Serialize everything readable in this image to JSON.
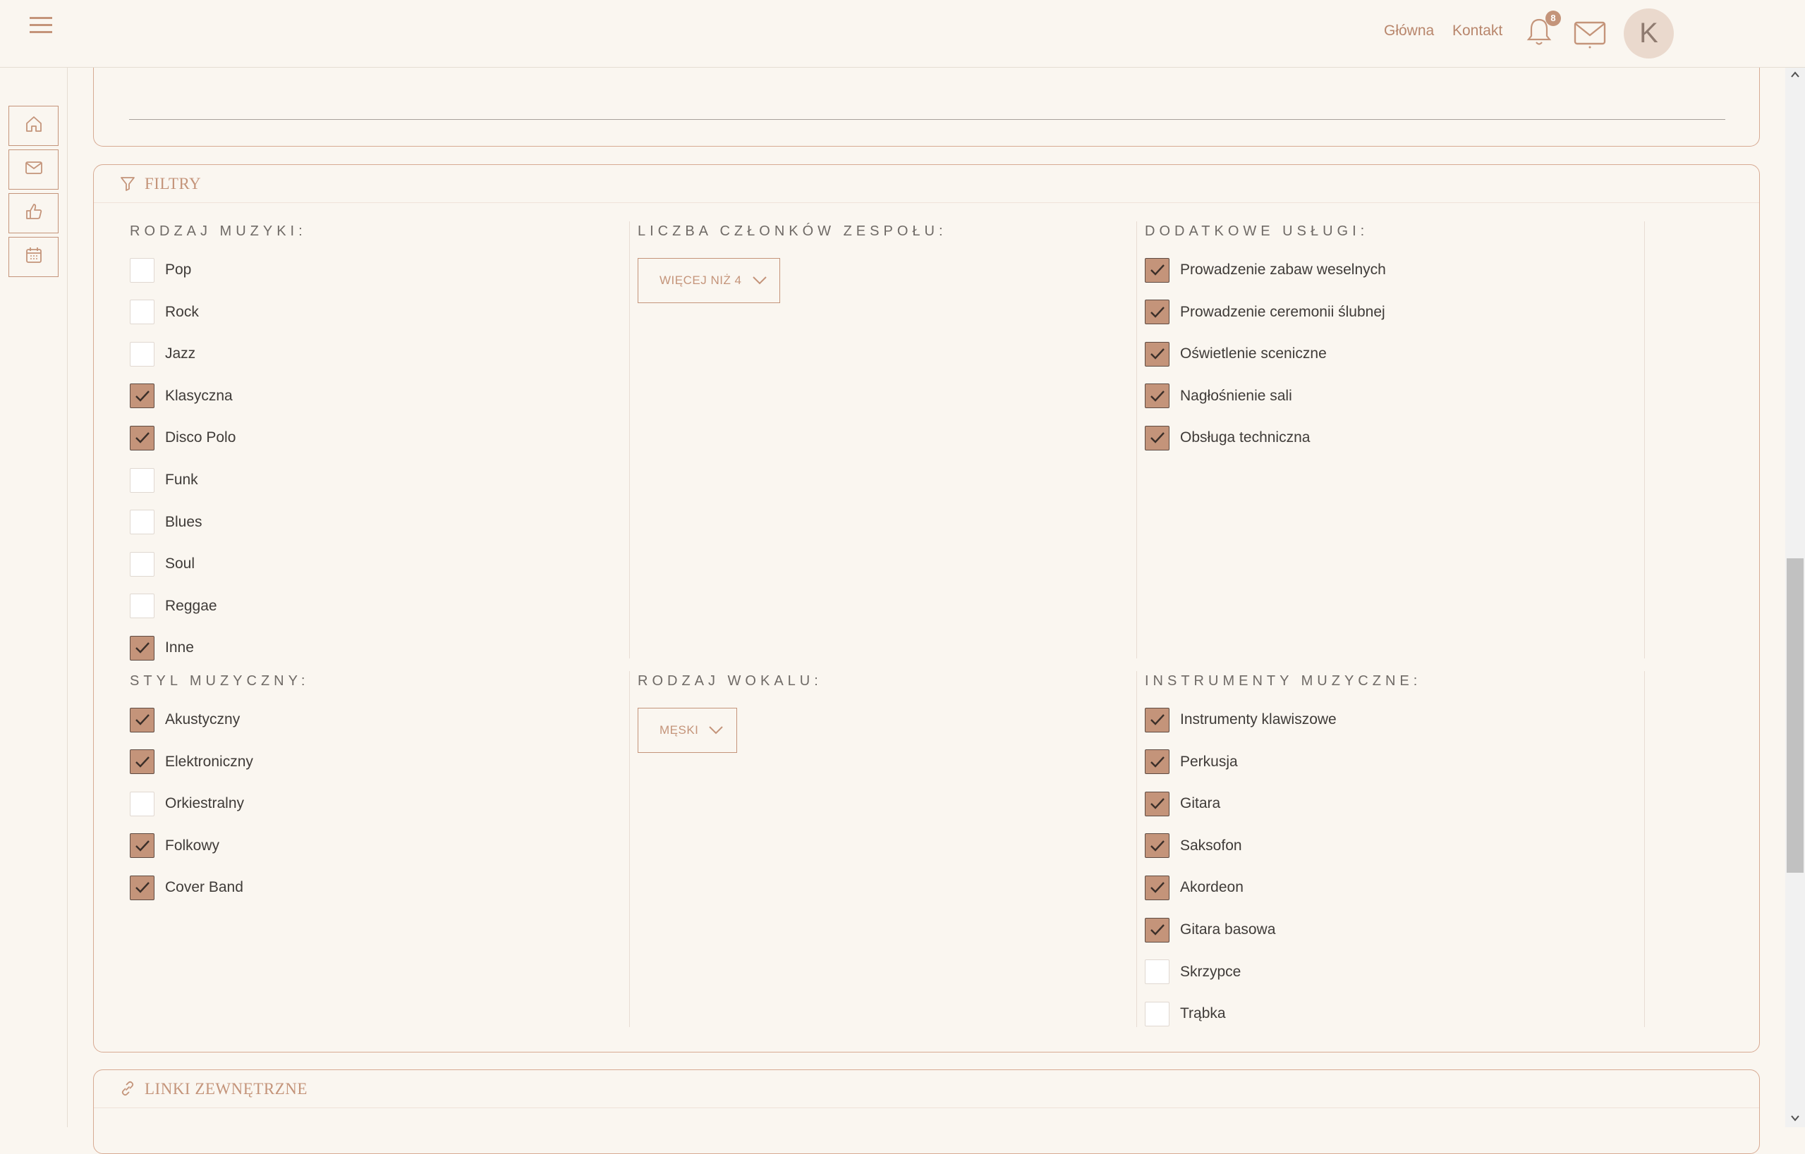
{
  "header": {
    "nav": [
      "Główna",
      "Kontakt"
    ],
    "notifications_count": "8",
    "avatar_initial": "K"
  },
  "rail": {
    "items": [
      "home-icon",
      "mail-icon",
      "thumbs-up-icon",
      "calendar-icon"
    ]
  },
  "filters": {
    "title": "FILTRY",
    "music_type": {
      "title": "RODZAJ MUZYKI:",
      "options": [
        {
          "label": "Pop",
          "checked": false
        },
        {
          "label": "Rock",
          "checked": false
        },
        {
          "label": "Jazz",
          "checked": false
        },
        {
          "label": "Klasyczna",
          "checked": true
        },
        {
          "label": "Disco Polo",
          "checked": true
        },
        {
          "label": "Funk",
          "checked": false
        },
        {
          "label": "Blues",
          "checked": false
        },
        {
          "label": "Soul",
          "checked": false
        },
        {
          "label": "Reggae",
          "checked": false
        },
        {
          "label": "Inne",
          "checked": true
        }
      ]
    },
    "members": {
      "title": "LICZBA CZŁONKÓW ZESPOŁU:",
      "selected": "WIĘCEJ NIŻ 4"
    },
    "extra_services": {
      "title": "DODATKOWE USŁUGI:",
      "options": [
        {
          "label": "Prowadzenie zabaw weselnych",
          "checked": true
        },
        {
          "label": "Prowadzenie ceremonii ślubnej",
          "checked": true
        },
        {
          "label": "Oświetlenie sceniczne",
          "checked": true
        },
        {
          "label": "Nagłośnienie sali",
          "checked": true
        },
        {
          "label": "Obsługa techniczna",
          "checked": true
        }
      ]
    },
    "music_style": {
      "title": "STYL MUZYCZNY:",
      "options": [
        {
          "label": "Akustyczny",
          "checked": true
        },
        {
          "label": "Elektroniczny",
          "checked": true
        },
        {
          "label": "Orkiestralny",
          "checked": false
        },
        {
          "label": "Folkowy",
          "checked": true
        },
        {
          "label": "Cover Band",
          "checked": true
        }
      ]
    },
    "vocal_type": {
      "title": "RODZAJ WOKALU:",
      "selected": "MĘSKI"
    },
    "instruments": {
      "title": "INSTRUMENTY MUZYCZNE:",
      "options": [
        {
          "label": "Instrumenty klawiszowe",
          "checked": true
        },
        {
          "label": "Perkusja",
          "checked": true
        },
        {
          "label": "Gitara",
          "checked": true
        },
        {
          "label": "Saksofon",
          "checked": true
        },
        {
          "label": "Akordeon",
          "checked": true
        },
        {
          "label": "Gitara basowa",
          "checked": true
        },
        {
          "label": "Skrzypce",
          "checked": false
        },
        {
          "label": "Trąbka",
          "checked": false
        }
      ]
    }
  },
  "links": {
    "title": "LINKI ZEWNĘTRZNE"
  },
  "colors": {
    "accent": "#c4947a",
    "background": "#faf6f0",
    "border": "#d7aa93"
  }
}
